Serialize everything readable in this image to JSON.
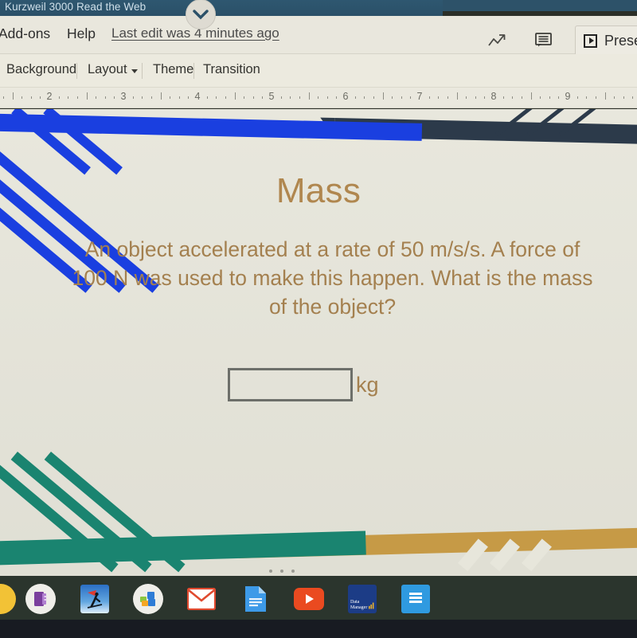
{
  "kurzweil": {
    "title": "Kurzweil 3000 Read the Web",
    "collapse_icon": "chevron-down-icon"
  },
  "menu": {
    "addons": "Add-ons",
    "help": "Help",
    "last_edit": "Last edit was 4 minutes ago",
    "trend_icon": "trend-arrow-icon",
    "comment_icon": "comment-icon",
    "present_label": "Present",
    "present_icon": "play-icon"
  },
  "toolbar": {
    "background": "Background",
    "layout": "Layout",
    "theme": "Theme",
    "transition": "Transition"
  },
  "ruler": {
    "numbers": [
      "2",
      "3",
      "4",
      "5",
      "6",
      "7",
      "8",
      "9"
    ]
  },
  "slide": {
    "title": "Mass",
    "body": "An object accelerated at a rate of 50 m/s/s. A force of 100 N was used to make this happen. What is the mass of the object?",
    "answer_value": "",
    "answer_placeholder": "",
    "answer_unit": "kg",
    "colors": {
      "background": "#e7e6db",
      "text": "#a4804f",
      "title": "#b0874f",
      "accent_blue": "#1a3fe0",
      "accent_navy": "#2c3a4a",
      "accent_green": "#1a8470",
      "accent_gold": "#c69a46"
    }
  },
  "shelf": {
    "apps": [
      {
        "name": "launcher-partial-icon",
        "label": ""
      },
      {
        "name": "onenote-icon",
        "label": ""
      },
      {
        "name": "skier-app-icon",
        "label": ""
      },
      {
        "name": "microsoft-office-icon",
        "label": ""
      },
      {
        "name": "gmail-icon",
        "label": "M"
      },
      {
        "name": "google-docs-icon",
        "label": ""
      },
      {
        "name": "youtube-icon",
        "label": ""
      },
      {
        "name": "data-manager-icon",
        "label": "Data Manager"
      },
      {
        "name": "google-slides-doc-icon",
        "label": ""
      }
    ]
  }
}
